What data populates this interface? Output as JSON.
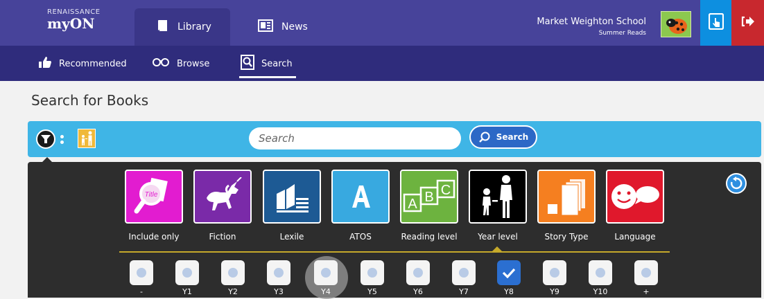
{
  "brand": {
    "line1": "RENAISSANCE",
    "line2": "myON"
  },
  "topnav": {
    "tabs": [
      {
        "label": "Library",
        "icon": "book-icon",
        "active": true
      },
      {
        "label": "News",
        "icon": "newspaper-icon",
        "active": false
      }
    ]
  },
  "account": {
    "school": "Market Weighton School",
    "group": "Summer Reads"
  },
  "subnav": {
    "items": [
      {
        "label": "Recommended",
        "icon": "thumbs-up-icon"
      },
      {
        "label": "Browse",
        "icon": "glasses-icon"
      },
      {
        "label": "Search",
        "icon": "search-icon",
        "active": true
      }
    ]
  },
  "page": {
    "title": "Search for Books"
  },
  "search": {
    "placeholder": "Search",
    "button": "Search"
  },
  "categories": [
    {
      "label": "Include only",
      "color": "#e21cd0",
      "icon": "title-magnifier-icon"
    },
    {
      "label": "Fiction",
      "color": "#7a2aa8",
      "icon": "unicorn-icon"
    },
    {
      "label": "Lexile",
      "color": "#1d5a94",
      "icon": "books-icon"
    },
    {
      "label": "ATOS",
      "color": "#38a9e0",
      "icon": "letter-a-icon"
    },
    {
      "label": "Reading level",
      "color": "#6db33f",
      "icon": "abc-blocks-icon"
    },
    {
      "label": "Year level",
      "color": "#000000",
      "icon": "child-adult-icon",
      "active": true
    },
    {
      "label": "Story Type",
      "color": "#f57f20",
      "icon": "pages-icon"
    },
    {
      "label": "Language",
      "color": "#e0182c",
      "icon": "speech-face-icon"
    }
  ],
  "years": [
    {
      "label": "-",
      "checked": false
    },
    {
      "label": "Y1",
      "checked": false
    },
    {
      "label": "Y2",
      "checked": false
    },
    {
      "label": "Y3",
      "checked": false
    },
    {
      "label": "Y4",
      "checked": false
    },
    {
      "label": "Y5",
      "checked": false
    },
    {
      "label": "Y6",
      "checked": false
    },
    {
      "label": "Y7",
      "checked": false
    },
    {
      "label": "Y8",
      "checked": true
    },
    {
      "label": "Y9",
      "checked": false
    },
    {
      "label": "Y10",
      "checked": false
    },
    {
      "label": "+",
      "checked": false
    }
  ],
  "colors": {
    "topbar": "#47439a",
    "subnav": "#2f2c7c",
    "searchbar": "#3fb5e6",
    "panel": "#2d2d2d",
    "accent_line": "#c5a92a",
    "tablet_btn": "#0d8fe0",
    "logout_btn": "#c8282e"
  }
}
